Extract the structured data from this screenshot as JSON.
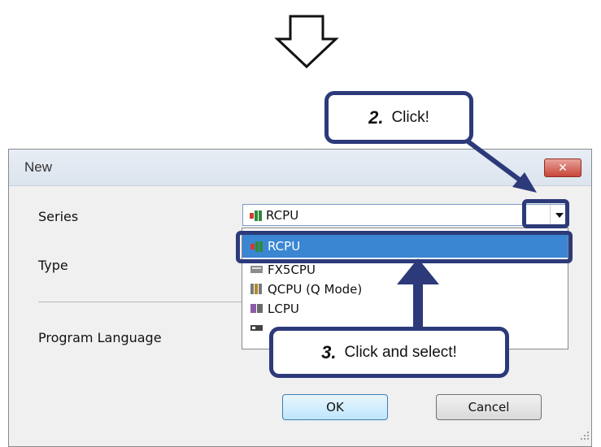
{
  "dialog": {
    "title": "New",
    "close_glyph": "✕",
    "fields": {
      "series_label": "Series",
      "type_label": "Type",
      "program_language_label": "Program Language"
    },
    "series_select": {
      "selected": "RCPU",
      "options": [
        {
          "label": "RCPU",
          "icon": "rcpu-icon",
          "selected": true
        },
        {
          "label": "FX5CPU",
          "icon": "fx5cpu-icon"
        },
        {
          "label": "QCPU (Q Mode)",
          "icon": "qcpu-icon"
        },
        {
          "label": "LCPU",
          "icon": "lcpu-icon"
        },
        {
          "label": "",
          "icon": "fxcpu-icon"
        }
      ]
    },
    "buttons": {
      "ok": "OK",
      "cancel": "Cancel"
    }
  },
  "callouts": {
    "step2": {
      "number": "2.",
      "text": "Click!"
    },
    "step3": {
      "number": "3.",
      "text": "Click and select!"
    }
  },
  "colors": {
    "callout_border": "#2c3a7a",
    "selection": "#3a86d2",
    "close_button": "#c8453a"
  }
}
